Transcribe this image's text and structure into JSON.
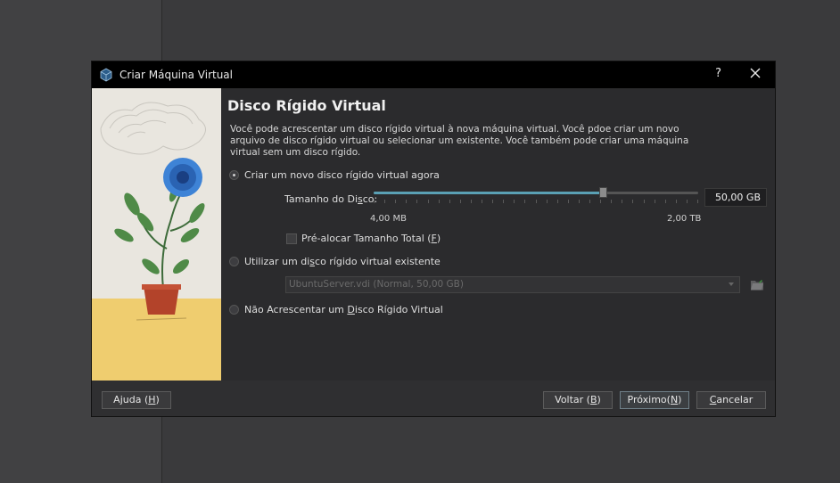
{
  "window": {
    "title": "Criar Máquina Virtual",
    "help_glyph": "?"
  },
  "page": {
    "heading": "Disco Rígido Virtual",
    "description": "Você pode acrescentar um disco rígido virtual à nova máquina virtual. Você pdoe criar um novo arquivo de disco rígido virtual ou selecionar um existente. Você também pode criar uma máquina virtual sem um disco rígido."
  },
  "options": {
    "create_new": {
      "label": "Criar um novo disco rígido virtual agora",
      "checked": true
    },
    "use_existing": {
      "label_a": "Utilizar um di",
      "label_u": "s",
      "label_b": "co rígido virtual existente",
      "checked": false
    },
    "no_disk": {
      "label_a": "Não Acrescentar um ",
      "label_u": "D",
      "label_b": "isco Rígido Virtual",
      "checked": false
    }
  },
  "disk_size": {
    "label_a": "Tamanho do Di",
    "label_u": "s",
    "label_b": "co:",
    "min_label": "4,00 MB",
    "max_label": "2,00 TB",
    "value": "50,00 GB",
    "slider_fraction": 0.705
  },
  "preallocate": {
    "label_a": "Pré-alocar Tamanho Total (",
    "label_u": "F",
    "label_b": ")",
    "checked": false
  },
  "existing_disk": {
    "selected": "UbuntuServer.vdi (Normal, 50,00 GB)"
  },
  "buttons": {
    "help": {
      "a": "Ajuda (",
      "u": "H",
      "b": ")"
    },
    "back": {
      "a": "Voltar (",
      "u": "B",
      "b": ")"
    },
    "next": {
      "a": "Próximo(",
      "u": "N",
      "b": ")"
    },
    "cancel": {
      "a": "",
      "u": "C",
      "b": "ancelar"
    }
  },
  "icons": {
    "app": "virtualbox-cube-icon",
    "close": "close-icon",
    "folder": "folder-open-icon",
    "combo": "chevron-down-icon"
  },
  "colors": {
    "slider_fill": "#5aa0b4",
    "art_wall": "#e9e6df",
    "art_floor": "#efcd6f",
    "flower": "#3e83d6"
  }
}
